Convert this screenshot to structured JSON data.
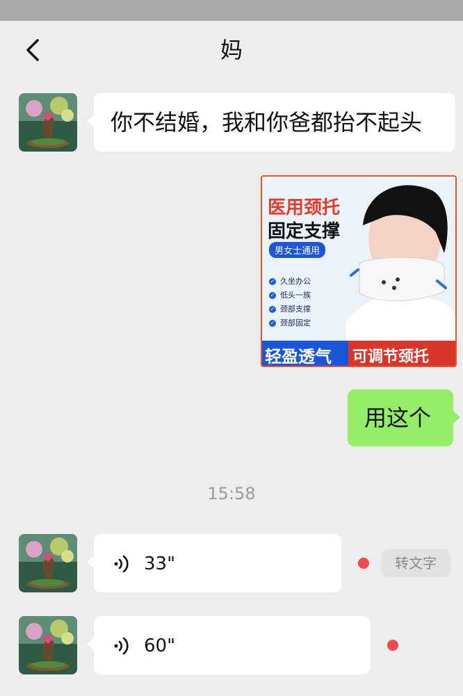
{
  "header": {
    "title": "妈",
    "back_icon": "chevron-left-icon"
  },
  "messages": {
    "text_in": "你不结婚，我和你爸都抬不起头",
    "product_card": {
      "title_line1": "医用颈托",
      "title_line2": "固定支撑",
      "tag": "男女士通用",
      "features": [
        "久坐办公",
        "低头一族",
        "颈部支撑",
        "颈部固定"
      ],
      "banner_left": "轻盈透气",
      "banner_right": "可调节颈托"
    },
    "text_out": "用这个",
    "timestamp": "15:58",
    "voice1": {
      "duration": "33\"",
      "convert_label": "转文字"
    },
    "voice2": {
      "duration": "60\""
    }
  },
  "colors": {
    "incoming_bubble": "#ffffff",
    "outgoing_bubble": "#95ec69",
    "unread_dot": "#f0494e",
    "background": "#ededed"
  }
}
